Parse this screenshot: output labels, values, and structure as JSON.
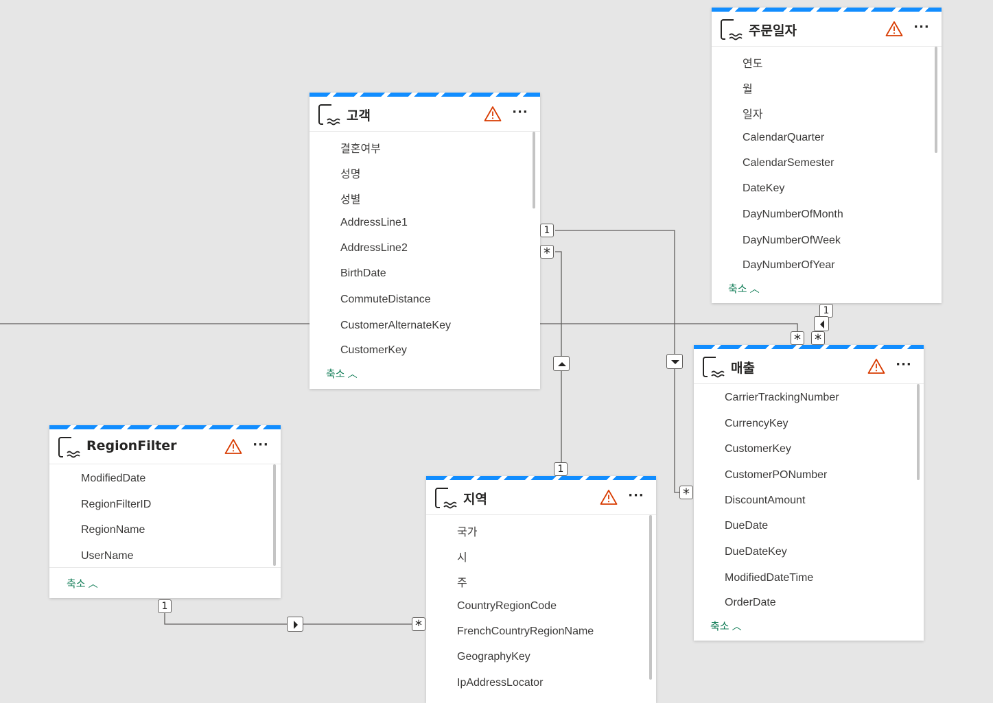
{
  "tables": {
    "customer": {
      "title": "고객",
      "fields": [
        "결혼여부",
        "성명",
        "성별",
        "AddressLine1",
        "AddressLine2",
        "BirthDate",
        "CommuteDistance",
        "CustomerAlternateKey",
        "CustomerKey"
      ],
      "collapse_label": "축소"
    },
    "order_date": {
      "title": "주문일자",
      "fields": [
        "연도",
        "월",
        "일자",
        "CalendarQuarter",
        "CalendarSemester",
        "DateKey",
        "DayNumberOfMonth",
        "DayNumberOfWeek",
        "DayNumberOfYear"
      ],
      "collapse_label": "축소"
    },
    "sales": {
      "title": "매출",
      "fields": [
        "CarrierTrackingNumber",
        "CurrencyKey",
        "CustomerKey",
        "CustomerPONumber",
        "DiscountAmount",
        "DueDate",
        "DueDateKey",
        "ModifiedDateTime",
        "OrderDate"
      ],
      "collapse_label": "축소"
    },
    "region_filter": {
      "title": "RegionFilter",
      "fields": [
        "ModifiedDate",
        "RegionFilterID",
        "RegionName",
        "UserName"
      ],
      "collapse_label": "축소"
    },
    "region": {
      "title": "지역",
      "fields": [
        "국가",
        "시",
        "주",
        "CountryRegionCode",
        "FrenchCountryRegionName",
        "GeographyKey",
        "IpAddressLocator"
      ]
    }
  },
  "cardinality": {
    "one": "1",
    "many": "*"
  },
  "icons": {
    "table": "lakehouse-table-icon",
    "warning": "warning-icon",
    "more": "more-options-icon",
    "collapse": "chevron-up-icon",
    "filter_direction": "filter-direction-arrow-icon"
  },
  "colors": {
    "header_stripe": "#118dff",
    "warning": "#d83b01",
    "collapse_link": "#0f7b55",
    "canvas": "#e6e6e6",
    "line": "#605e5c"
  }
}
